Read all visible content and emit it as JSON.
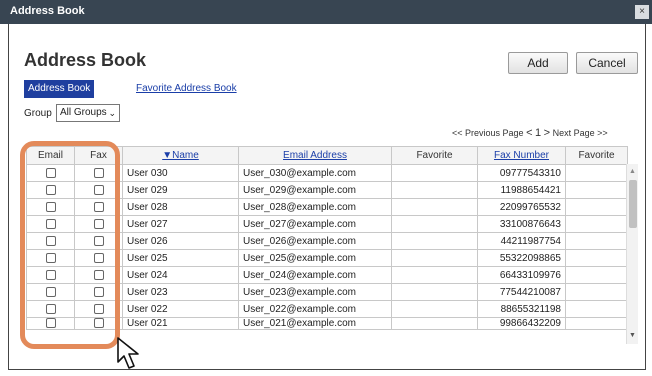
{
  "window": {
    "title": "Address Book",
    "close_glyph": "×"
  },
  "page": {
    "heading": "Address Book"
  },
  "actions": {
    "add_label": "Add",
    "cancel_label": "Cancel"
  },
  "tabs": {
    "active": "Address Book",
    "other": "Favorite Address Book"
  },
  "group": {
    "label": "Group",
    "selected": "All Groups"
  },
  "pager": {
    "prev": "<< Previous Page",
    "lt": "<",
    "current": "1",
    "gt": ">",
    "next": "Next Page >>"
  },
  "table": {
    "headers": {
      "email": "Email",
      "fax": "Fax",
      "name": "▼Name",
      "email_address": "Email Address",
      "favorite_email": "Favorite",
      "fax_number": "Fax Number",
      "favorite_fax": "Favorite"
    },
    "rows": [
      {
        "name": "User 030",
        "email": "User_030@example.com",
        "fax": "09777543310",
        "email_checked": false,
        "fax_checked": false
      },
      {
        "name": "User 029",
        "email": "User_029@example.com",
        "fax": "11988654421",
        "email_checked": false,
        "fax_checked": false
      },
      {
        "name": "User 028",
        "email": "User_028@example.com",
        "fax": "22099765532",
        "email_checked": false,
        "fax_checked": false
      },
      {
        "name": "User 027",
        "email": "User_027@example.com",
        "fax": "33100876643",
        "email_checked": false,
        "fax_checked": false
      },
      {
        "name": "User 026",
        "email": "User_026@example.com",
        "fax": "44211987754",
        "email_checked": false,
        "fax_checked": false
      },
      {
        "name": "User 025",
        "email": "User_025@example.com",
        "fax": "55322098865",
        "email_checked": false,
        "fax_checked": false
      },
      {
        "name": "User 024",
        "email": "User_024@example.com",
        "fax": "66433109976",
        "email_checked": false,
        "fax_checked": false
      },
      {
        "name": "User 023",
        "email": "User_023@example.com",
        "fax": "77544210087",
        "email_checked": false,
        "fax_checked": false
      },
      {
        "name": "User 022",
        "email": "User_022@example.com",
        "fax": "88655321198",
        "email_checked": false,
        "fax_checked": false
      },
      {
        "name": "User 021",
        "email": "User_021@example.com",
        "fax": "99866432209",
        "email_checked": false,
        "fax_checked": false
      }
    ]
  },
  "annotation": {
    "highlight_color": "#e38a5a"
  },
  "cursor": {
    "icon": "mouse-pointer-icon"
  }
}
